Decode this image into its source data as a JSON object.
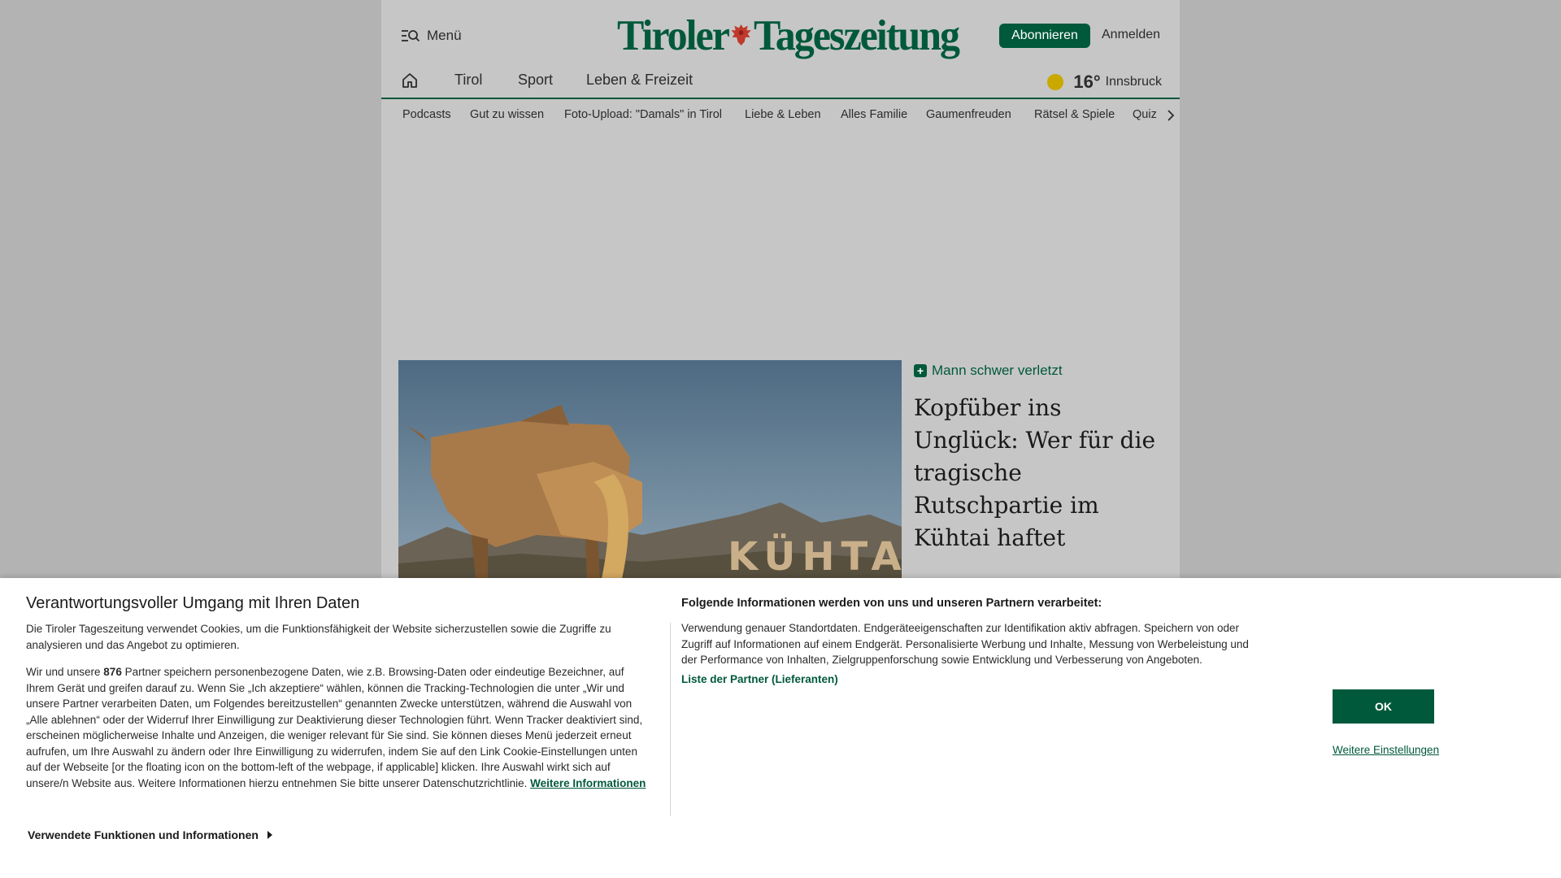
{
  "header": {
    "menu_label": "Menü",
    "logo_left": "Tiroler",
    "logo_right": "Tageszeitung",
    "subscribe_label": "Abonnieren",
    "login_label": "Anmelden"
  },
  "nav": {
    "items": [
      "Tirol",
      "Sport",
      "Leben & Freizeit"
    ],
    "weather": {
      "temperature": "16°",
      "city": "Innsbruck"
    }
  },
  "subnav": {
    "items": [
      "Podcasts",
      "Gut zu wissen",
      "Foto-Upload: \"Damals\" in Tirol",
      "Liebe & Leben",
      "Alles Familie",
      "Gaumenfreuden",
      "Rätsel & Spiele",
      "Quiz"
    ]
  },
  "teaser": {
    "kicker": "Mann schwer verletzt",
    "title": "Kopfüber ins Unglück: Wer für die tragische Rutschpartie im Kühtai haftet",
    "image_sign": "KÜHTAI"
  },
  "consent": {
    "title": "Verantwortungsvoller Umgang mit Ihren Daten",
    "text1": "Die Tiroler Tageszeitung verwendet Cookies, um die Funktionsfähigkeit der Website sicherzustellen sowie die Zugriffe zu analysieren und das Angebot zu optimieren.",
    "text2_before": "Wir und unsere ",
    "partner_count": "876",
    "text2_after": " Partner speichern personenbezogene Daten, wie z.B. Browsing-Daten oder eindeutige Bezeichner, auf Ihrem Gerät und greifen darauf zu. Wenn Sie „Ich akzeptiere“ wählen, können die Tracking-Technologien die unter „Wir und unsere Partner verarbeiten Daten, um Folgendes bereitzustellen“ genannten Zwecke unterstützen, während die Auswahl von „Alle ablehnen“ oder der Widerruf Ihrer Einwilligung zur Deaktivierung dieser Technologien führt. Wenn Tracker deaktiviert sind, erscheinen möglicherweise Inhalte und Anzeigen, die weniger relevant für Sie sind. Sie können dieses Menü jederzeit erneut aufrufen, um Ihre Auswahl zu ändern oder Ihre Einwilligung zu widerrufen, indem Sie auf den Link Cookie-Einstellungen unten auf der Webseite [or the floating icon on the bottom-left of the webpage, if applicable] klicken. Ihre Auswahl wirkt sich auf unsere/n Website aus. Weitere Informationen hierzu entnehmen Sie bitte unserer Datenschutzrichtlinie. ",
    "more_info_link": "Weitere Informationen",
    "expander_label": "Verwendete Funktionen und Informationen",
    "right_title": "Folgende Informationen werden von uns und unseren Partnern verarbeitet:",
    "right_text": "Verwendung genauer Standortdaten. Endgeräteeigenschaften zur Identifikation aktiv abfragen. Speichern von oder Zugriff auf Informationen auf einem Endgerät. Personalisierte Werbung und Inhalte, Messung von Werbeleistung und der Performance von Inhalten, Zielgruppenforschung sowie Entwicklung und Verbesserung von Angeboten.",
    "partners_link": "Liste der Partner (Lieferanten)",
    "ok_label": "OK",
    "settings_label": "Weitere Einstellungen"
  },
  "colors": {
    "brand_green": "#00593a",
    "overlay_gray": "#b3b3b3",
    "weather_sun": "#c9a800"
  }
}
